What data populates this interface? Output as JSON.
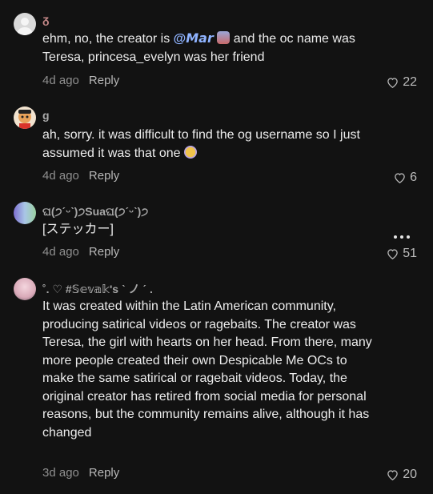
{
  "comments": [
    {
      "author": "ᵹ",
      "text_before": "ehm, no, the creator is ",
      "mention": "@𝙈𝙖𝙧",
      "text_after": " and the oc name was Teresa, princesa_evelyn was her friend",
      "time": "4d ago",
      "reply": "Reply",
      "likes": "22",
      "avatar_icon": "default-avatar-icon"
    },
    {
      "author": "g",
      "text": "ah, sorry. it was difficult to find the og username so I just assumed it was that one ",
      "time": "4d ago",
      "reply": "Reply",
      "likes": "6",
      "avatar_icon": "cartoon-avatar-icon"
    },
    {
      "author": "ଘ(੭ˊᵕˋ)੭Suaଘ(੭ˊᵕˋ)੭",
      "text": "[ステッカー]",
      "time": "4d ago",
      "reply": "Reply",
      "likes": "51",
      "avatar_icon": "gradient-avatar-icon"
    },
    {
      "author": "˚. ♡ #𝕊𝕖𝕧𝕒𝕜's ˋ ノ ˊ .",
      "text": "It was created within the Latin American community, producing satirical videos or ragebaits. The creator was Teresa, the girl with hearts on her head. From there, many more people created their own Despicable Me OCs to make the same satirical or ragebait videos. Today, the original creator has retired from social media for personal reasons, but the community remains alive, although it has changed",
      "time": "3d ago",
      "reply": "Reply",
      "likes": "20",
      "avatar_icon": "photo-avatar-icon"
    }
  ],
  "colors": {
    "background": "#121212",
    "text": "#ececec",
    "muted": "#8f8f8f",
    "mention": "#8fb3ff"
  }
}
